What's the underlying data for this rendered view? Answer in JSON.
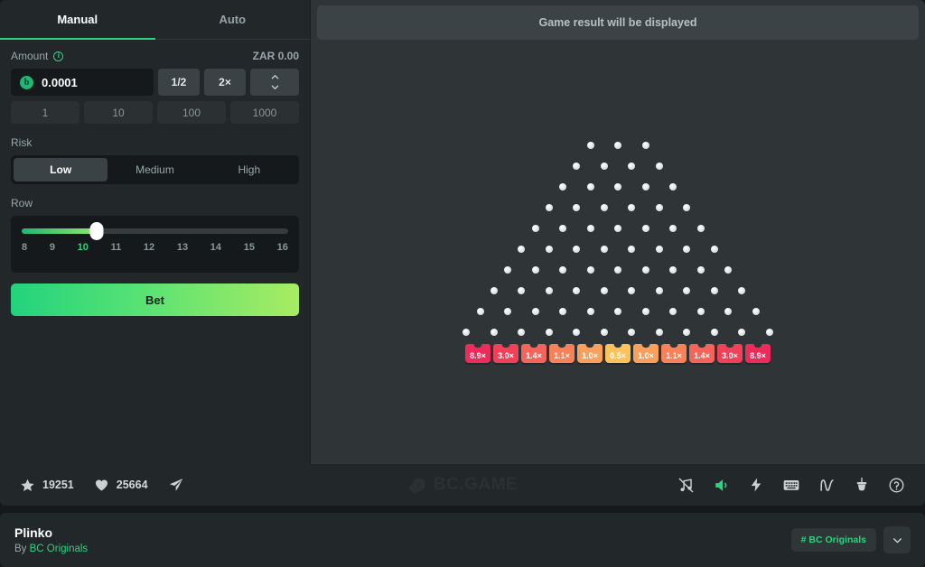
{
  "panel": {
    "tabs": [
      {
        "label": "Manual",
        "active": true
      },
      {
        "label": "Auto",
        "active": false
      }
    ],
    "amount": {
      "label": "Amount",
      "info_icon": "info-circle-icon",
      "balance": "ZAR 0.00",
      "currency_icon": "bitcoin-coin-icon",
      "currency_symbol": "b",
      "value": "0.0001",
      "placeholder": "0.0001",
      "half_label": "1/2",
      "double_label": "2×",
      "stepper_icon": "up-down-chevron-icon"
    },
    "quick_amounts": [
      "1",
      "10",
      "100",
      "1000"
    ],
    "risk": {
      "label": "Risk",
      "options": [
        "Low",
        "Medium",
        "High"
      ],
      "selected": "Low"
    },
    "row": {
      "label": "Row",
      "ticks": [
        "8",
        "9",
        "10",
        "11",
        "12",
        "13",
        "14",
        "15",
        "16"
      ],
      "selected": "10",
      "fill_percent": "28%"
    },
    "bet_button": "Bet"
  },
  "board": {
    "result_text": "Game result will be displayed",
    "peg_rows": [
      3,
      4,
      5,
      6,
      7,
      8,
      9,
      10,
      11,
      12
    ],
    "buckets": [
      {
        "label": "8.9×",
        "color": "#ec2b5a"
      },
      {
        "label": "3.0×",
        "color": "#f04159"
      },
      {
        "label": "1.4×",
        "color": "#f4645a"
      },
      {
        "label": "1.1×",
        "color": "#f7825a"
      },
      {
        "label": "1.0×",
        "color": "#f9a05c"
      },
      {
        "label": "0.5×",
        "color": "#fbc25e"
      },
      {
        "label": "1.0×",
        "color": "#f9a05c"
      },
      {
        "label": "1.1×",
        "color": "#f7825a"
      },
      {
        "label": "1.4×",
        "color": "#f4645a"
      },
      {
        "label": "3.0×",
        "color": "#f04159"
      },
      {
        "label": "8.9×",
        "color": "#ec2b5a"
      }
    ]
  },
  "toolbar": {
    "favorites": {
      "icon": "star-icon",
      "count": "19251"
    },
    "likes": {
      "icon": "heart-icon",
      "count": "25664"
    },
    "share": {
      "icon": "share-send-icon"
    },
    "watermark": "BC.GAME",
    "right_icons": [
      {
        "name": "music-off-icon",
        "active": false
      },
      {
        "name": "sound-on-icon",
        "active": true
      },
      {
        "name": "lightning-icon",
        "active": false
      },
      {
        "name": "keyboard-icon",
        "active": false
      },
      {
        "name": "trend-line-icon",
        "active": false
      },
      {
        "name": "fairness-icon",
        "active": false
      },
      {
        "name": "help-icon",
        "active": false
      }
    ],
    "accent_color": "#2cd380"
  },
  "footer": {
    "title": "Plinko",
    "by_prefix": "By",
    "provider": "BC Originals",
    "tag": "# BC Originals",
    "caret_icon": "chevron-down-icon"
  }
}
